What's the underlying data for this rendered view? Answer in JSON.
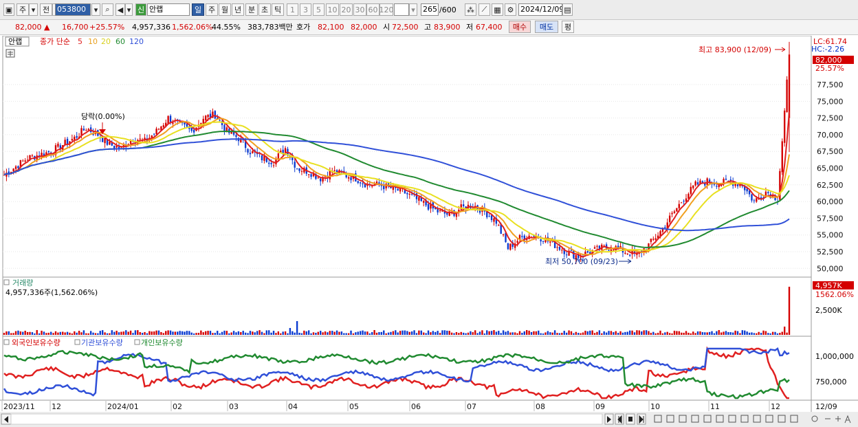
{
  "toolbar": {
    "code": "053800",
    "stock_name": "안랩",
    "badge": "신",
    "week_btn": "주",
    "prev_btn": "전",
    "periods": [
      "일",
      "주",
      "월",
      "년",
      "분",
      "초",
      "틱"
    ],
    "minute_units": [
      "1",
      "3",
      "5",
      "10",
      "20",
      "30",
      "60",
      "120"
    ],
    "count": "265",
    "count_max": "/600",
    "date": "2024/12/09"
  },
  "quote": {
    "price": "82,000",
    "change": "16,700",
    "change_pct": "+25.57%",
    "volume": "4,957,336",
    "volume_pct": "1,562.06%",
    "ratio": "44.55%",
    "amount": "383,783백만",
    "bid_label": "호가",
    "ask": "82,100",
    "bid": "82,000",
    "open_label": "시",
    "open": "72,500",
    "high_label": "고",
    "high": "83,900",
    "low_label": "저",
    "low": "67,400",
    "buy_btn": "매수",
    "sell_btn": "매도",
    "avg_btn": "평"
  },
  "price_panel": {
    "stock": "안랩",
    "legend_label": "종가 단순",
    "ma_periods": [
      "5",
      "10",
      "20",
      "60",
      "120"
    ],
    "ma_colors": [
      "#e02020",
      "#f0a020",
      "#e8e020",
      "#208a30",
      "#3050d8"
    ],
    "lc": "LC:61.74",
    "hc": "HC:-2.26",
    "price_tag": "82,000",
    "pct_tag": "25.57%",
    "high_note": "최고 83,900 (12/09)",
    "low_note": "최저 50,700 (09/23)",
    "event_note": "당락(0.00%)"
  },
  "volume_panel": {
    "title": "거래량",
    "value_text": "4,957,336주(1,562.06%)",
    "tag_value": "4,957K",
    "tag_pct": "1562.06%",
    "tick": "2,500K"
  },
  "holding_panel": {
    "legend": [
      "외국인보유수량",
      "기관보유수량",
      "개인보유수량"
    ],
    "colors": [
      "#e02020",
      "#3050d8",
      "#208a30"
    ],
    "ticks": [
      "1,000,000",
      "750,000"
    ]
  },
  "chart_data": {
    "type": "candlestick",
    "price_axis": [
      "77,500",
      "75,000",
      "72,500",
      "70,000",
      "67,500",
      "65,000",
      "62,500",
      "60,000",
      "57,500",
      "55,000",
      "52,500",
      "50,000"
    ],
    "price_range": [
      49000,
      84500
    ],
    "x_labels": [
      "2023/11",
      "12",
      "2024/01",
      "02",
      "03",
      "04",
      "05",
      "06",
      "07",
      "08",
      "09",
      "10",
      "11",
      "12",
      "12/09"
    ],
    "close_path": [
      [
        0,
        64000
      ],
      [
        10,
        66500
      ],
      [
        20,
        67500
      ],
      [
        30,
        69500
      ],
      [
        35,
        71000
      ],
      [
        40,
        70000
      ],
      [
        45,
        68500
      ],
      [
        50,
        68000
      ],
      [
        55,
        69500
      ],
      [
        60,
        69000
      ],
      [
        65,
        70500
      ],
      [
        70,
        72500
      ],
      [
        75,
        71500
      ],
      [
        80,
        70500
      ],
      [
        85,
        72500
      ],
      [
        90,
        73000
      ],
      [
        95,
        70500
      ],
      [
        100,
        69500
      ],
      [
        105,
        67500
      ],
      [
        110,
        66500
      ],
      [
        115,
        66000
      ],
      [
        120,
        68000
      ],
      [
        125,
        65000
      ],
      [
        130,
        64500
      ],
      [
        135,
        63500
      ],
      [
        140,
        64500
      ],
      [
        145,
        64000
      ],
      [
        150,
        63500
      ],
      [
        155,
        62500
      ],
      [
        160,
        62500
      ],
      [
        165,
        62000
      ],
      [
        170,
        61500
      ],
      [
        175,
        60500
      ],
      [
        180,
        59500
      ],
      [
        185,
        58500
      ],
      [
        190,
        58000
      ],
      [
        195,
        59000
      ],
      [
        200,
        59500
      ],
      [
        205,
        58500
      ],
      [
        210,
        57000
      ],
      [
        215,
        53000
      ],
      [
        220,
        54500
      ],
      [
        225,
        55000
      ],
      [
        230,
        54500
      ],
      [
        235,
        53500
      ],
      [
        240,
        52500
      ],
      [
        245,
        51800
      ],
      [
        250,
        52500
      ],
      [
        255,
        53000
      ],
      [
        260,
        53200
      ],
      [
        265,
        52500
      ],
      [
        270,
        52000
      ],
      [
        275,
        53500
      ],
      [
        280,
        55500
      ],
      [
        285,
        58000
      ],
      [
        290,
        60500
      ],
      [
        295,
        62500
      ],
      [
        300,
        63000
      ],
      [
        305,
        62700
      ],
      [
        310,
        63000
      ],
      [
        315,
        62500
      ],
      [
        320,
        60000
      ],
      [
        325,
        61500
      ],
      [
        330,
        60500
      ],
      [
        335,
        82000
      ]
    ]
  }
}
